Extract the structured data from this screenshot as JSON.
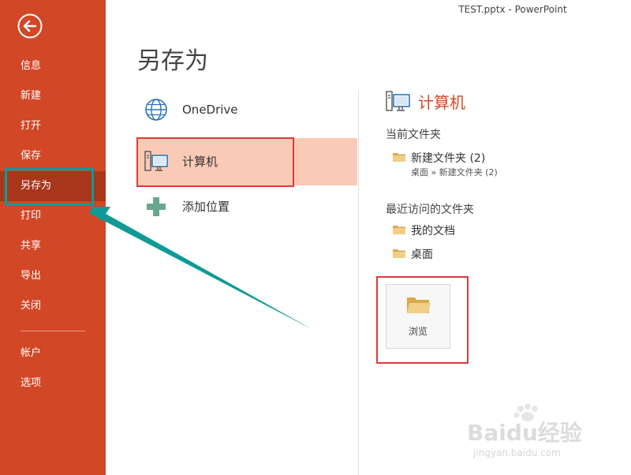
{
  "window": {
    "title": "TEST.pptx - PowerPoint"
  },
  "sidebar": {
    "back_label": "返回",
    "items": [
      {
        "label": "信息"
      },
      {
        "label": "新建"
      },
      {
        "label": "打开"
      },
      {
        "label": "保存"
      },
      {
        "label": "另存为"
      },
      {
        "label": "打印"
      },
      {
        "label": "共享"
      },
      {
        "label": "导出"
      },
      {
        "label": "关闭"
      },
      {
        "label": "帐户"
      },
      {
        "label": "选项"
      }
    ],
    "active_item": "另存为"
  },
  "main": {
    "title": "另存为",
    "places": [
      {
        "label": "OneDrive",
        "icon": "globe-icon"
      },
      {
        "label": "计算机",
        "icon": "computer-icon",
        "selected": true
      },
      {
        "label": "添加位置",
        "icon": "plus-icon"
      }
    ]
  },
  "right_panel": {
    "header": "计算机",
    "current_folder_label": "当前文件夹",
    "current_folder": {
      "name": "新建文件夹 (2)",
      "path": "桌面 » 新建文件夹 (2)"
    },
    "recent_folders_label": "最近访问的文件夹",
    "recent_folders": [
      {
        "name": "我的文档"
      },
      {
        "name": "桌面"
      }
    ],
    "browse_label": "浏览"
  },
  "watermark": {
    "text": "Baidu经验",
    "url_text": "jingyan.baidu.com"
  },
  "colors": {
    "accent": "#d24726",
    "sidebar_active": "#a8361b",
    "selected_place": "#f9cbb7",
    "highlight_box": "#e03a3a",
    "annotation_teal": "#0f9a96",
    "folder": "#e8c27a"
  }
}
